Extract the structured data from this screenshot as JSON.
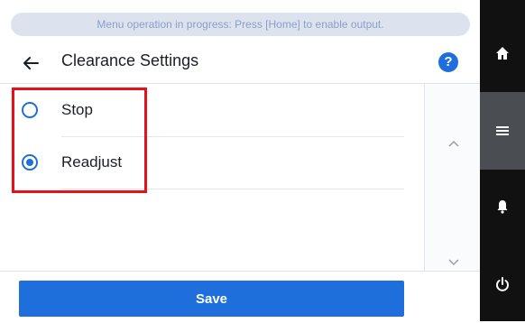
{
  "banner": {
    "text": "Menu operation in progress: Press [Home] to enable output."
  },
  "header": {
    "title": "Clearance Settings",
    "help_icon": "question-icon",
    "back_icon": "arrow-left-icon"
  },
  "options": [
    {
      "label": "Stop",
      "selected": false
    },
    {
      "label": "Readjust",
      "selected": true
    }
  ],
  "footer": {
    "save_label": "Save"
  },
  "sidebar": {
    "items": [
      {
        "icon": "home-icon"
      },
      {
        "icon": "menu-icon",
        "active": true
      },
      {
        "icon": "bell-icon"
      },
      {
        "icon": "power-icon"
      }
    ]
  },
  "colors": {
    "accent": "#1e6fdb",
    "highlight": "#e8101a",
    "sidebar": "#111111"
  }
}
